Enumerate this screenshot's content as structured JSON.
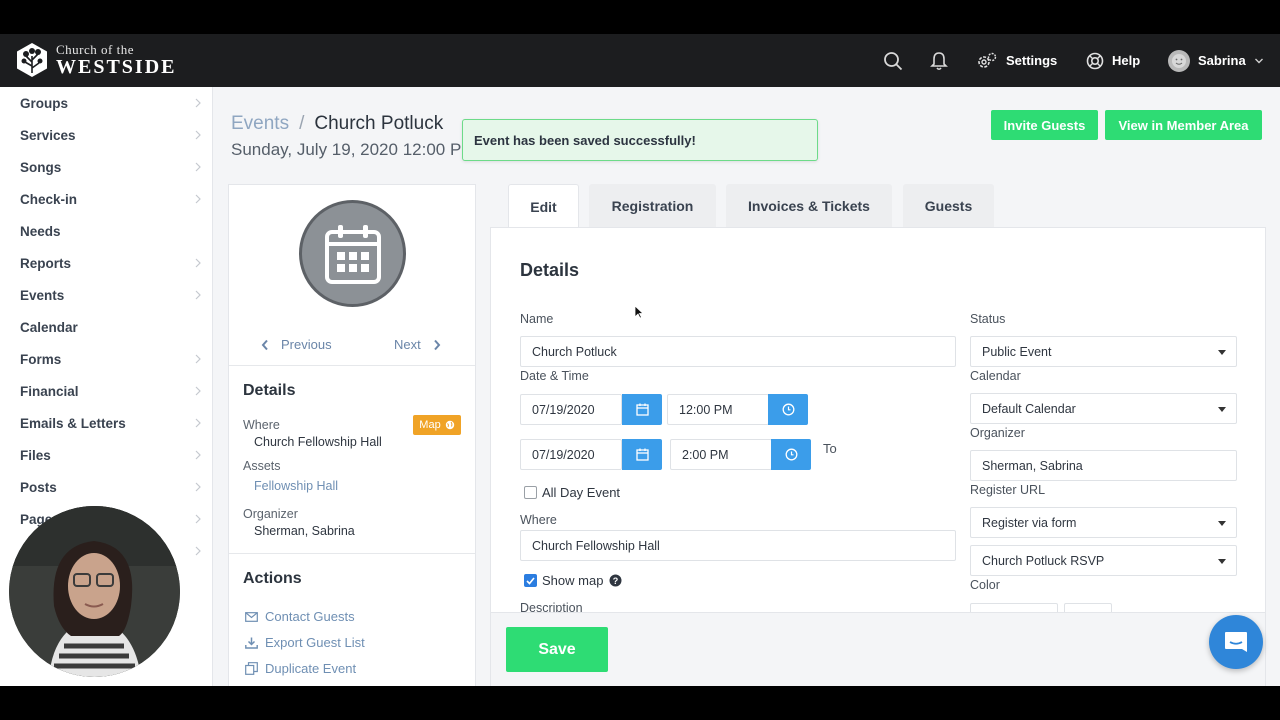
{
  "brand": {
    "line1": "Church of the",
    "line2": "WESTSIDE"
  },
  "topbar": {
    "settings_label": "Settings",
    "help_label": "Help",
    "user_name": "Sabrina"
  },
  "sidebar": {
    "items": [
      {
        "label": "Groups",
        "has_chevron": true
      },
      {
        "label": "Services",
        "has_chevron": true
      },
      {
        "label": "Songs",
        "has_chevron": true
      },
      {
        "label": "Check-in",
        "has_chevron": true
      },
      {
        "label": "Needs",
        "has_chevron": false
      },
      {
        "label": "Reports",
        "has_chevron": true
      },
      {
        "label": "Events",
        "has_chevron": true
      },
      {
        "label": "Calendar",
        "has_chevron": false
      },
      {
        "label": "Forms",
        "has_chevron": true
      },
      {
        "label": "Financial",
        "has_chevron": true
      },
      {
        "label": "Emails & Letters",
        "has_chevron": true
      },
      {
        "label": "Files",
        "has_chevron": true
      },
      {
        "label": "Posts",
        "has_chevron": true
      },
      {
        "label": "Pages",
        "has_chevron": true
      }
    ]
  },
  "breadcrumb": {
    "parent": "Events",
    "separator": "/",
    "current": "Church Potluck"
  },
  "event_date": "Sunday, July 19, 2020 12:00 P",
  "toast": {
    "message": "Event has been saved successfully!"
  },
  "header_buttons": {
    "invite": "Invite Guests",
    "member_area": "View in Member Area"
  },
  "left_card": {
    "pager": {
      "previous": "Previous",
      "next": "Next"
    },
    "details_title": "Details",
    "where_label": "Where",
    "where_value": "Church Fellowship Hall",
    "map_badge": "Map",
    "assets_label": "Assets",
    "assets_value": "Fellowship Hall",
    "organizer_label": "Organizer",
    "organizer_value": "Sherman, Sabrina",
    "actions_title": "Actions",
    "actions": [
      "Contact Guests",
      "Export Guest List",
      "Duplicate Event"
    ]
  },
  "tabs": [
    {
      "label": "Edit",
      "active": true
    },
    {
      "label": "Registration",
      "active": false
    },
    {
      "label": "Invoices & Tickets",
      "active": false
    },
    {
      "label": "Guests",
      "active": false
    }
  ],
  "form": {
    "title": "Details",
    "name_label": "Name",
    "name_value": "Church Potluck",
    "datetime_label": "Date & Time",
    "start_date": "07/19/2020",
    "start_time": "12:00 PM",
    "to_label": "To",
    "end_date": "07/19/2020",
    "end_time": "2:00 PM",
    "all_day_label": "All Day Event",
    "all_day_checked": false,
    "where_label": "Where",
    "where_value": "Church Fellowship Hall",
    "show_map_label": "Show map",
    "show_map_checked": true,
    "description_label": "Description",
    "status_label": "Status",
    "status_value": "Public Event",
    "calendar_label": "Calendar",
    "calendar_value": "Default Calendar",
    "organizer_label": "Organizer",
    "organizer_value": "Sherman, Sabrina",
    "register_url_label": "Register URL",
    "register_url_value": "Register via form",
    "register_form_value": "Church Potluck RSVP",
    "color_label": "Color"
  },
  "save_label": "Save",
  "colors": {
    "accent_green": "#2edc74",
    "accent_blue": "#3b9dea",
    "topbar": "#1c1d1f",
    "badge_orange": "#f0a326"
  }
}
